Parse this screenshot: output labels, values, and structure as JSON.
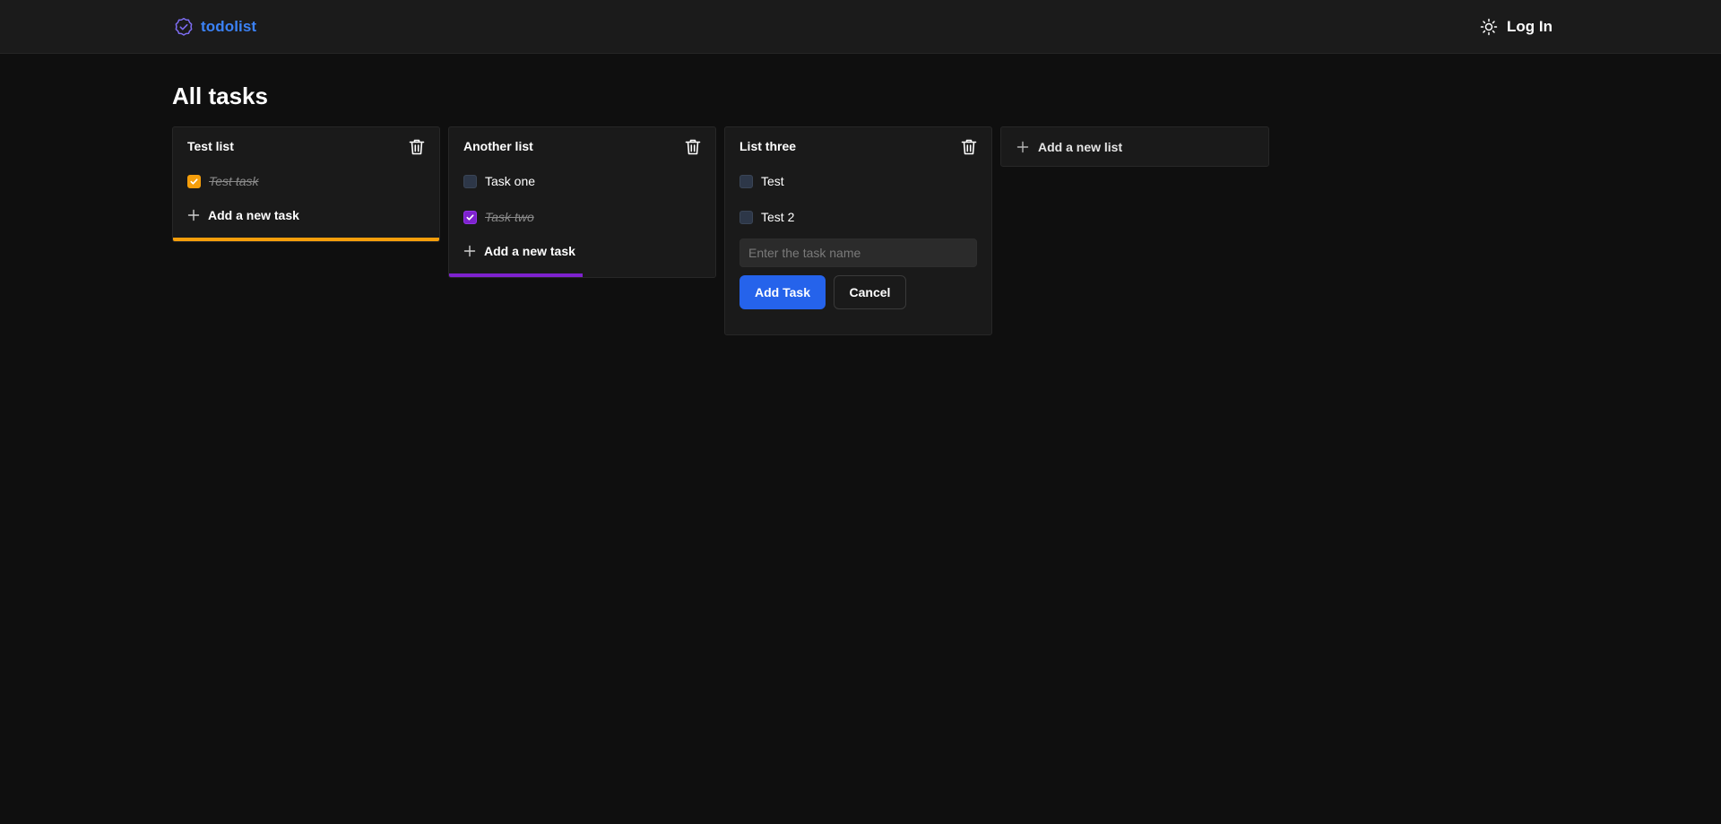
{
  "header": {
    "brand": "todolist",
    "brand_icon": "check-badge-icon",
    "theme_icon": "sun-icon",
    "login_label": "Log In",
    "brand_color": "#3b82f6"
  },
  "page": {
    "title": "All tasks"
  },
  "lists": [
    {
      "title": "Test list",
      "accent_color": "#f59e0b",
      "progress": 1.0,
      "tasks": [
        {
          "label": "Test task",
          "done": true
        }
      ],
      "add_task_label": "Add a new task"
    },
    {
      "title": "Another list",
      "accent_color": "#7e22ce",
      "progress": 0.5,
      "tasks": [
        {
          "label": "Task one",
          "done": false
        },
        {
          "label": "Task two",
          "done": true
        }
      ],
      "add_task_label": "Add a new task"
    },
    {
      "title": "List three",
      "tasks": [
        {
          "label": "Test",
          "done": false
        },
        {
          "label": "Test 2",
          "done": false
        }
      ],
      "new_task_form": {
        "placeholder": "Enter the task name",
        "value": "",
        "submit_label": "Add Task",
        "cancel_label": "Cancel"
      }
    }
  ],
  "add_list": {
    "label": "Add a new list"
  },
  "colors": {
    "primary_button": "#2563eb"
  }
}
